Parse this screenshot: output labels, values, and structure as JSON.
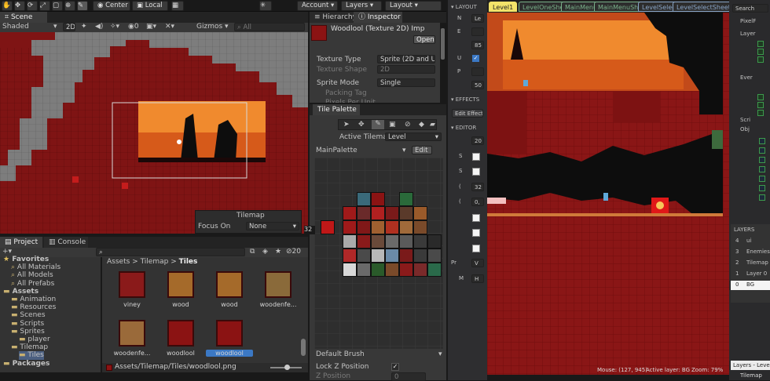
{
  "toolbar": {
    "center": "Center",
    "local": "Local",
    "account": "Account",
    "layers": "Layers",
    "layout": "Layout"
  },
  "scene": {
    "tab": "Scene",
    "shading": "Shaded",
    "mode2d": "2D",
    "gizmos": "Gizmos",
    "search_placeholder": "All"
  },
  "tilemap_overlay": {
    "title": "Tilemap",
    "focus_label": "Focus On",
    "focus_value": "None"
  },
  "project": {
    "tab_project": "Project",
    "tab_console": "Console",
    "count": "20",
    "tree": [
      {
        "label": "Favorites",
        "level": 0
      },
      {
        "label": "All Materials",
        "level": 1
      },
      {
        "label": "All Models",
        "level": 1
      },
      {
        "label": "All Prefabs",
        "level": 1
      },
      {
        "label": "Assets",
        "level": 0
      },
      {
        "label": "Animation",
        "level": 1
      },
      {
        "label": "Resources",
        "level": 1
      },
      {
        "label": "Scenes",
        "level": 1
      },
      {
        "label": "Scripts",
        "level": 1
      },
      {
        "label": "Sprites",
        "level": 1
      },
      {
        "label": "player",
        "level": 2
      },
      {
        "label": "Tilemap",
        "level": 1
      },
      {
        "label": "Tiles",
        "level": 2
      },
      {
        "label": "Packages",
        "level": 0
      }
    ],
    "breadcrumb": [
      "Assets",
      "Tilemap",
      "Tiles"
    ],
    "assets": [
      "viney",
      "wood",
      "wood",
      "woodenfe...",
      "woodenfe...",
      "woodlool",
      "woodlool"
    ],
    "path": "Assets/Tilemap/Tiles/woodlool.png"
  },
  "inspector": {
    "tab_hierarchy": "Hierarchy",
    "tab_inspector": "Inspector",
    "title": "Woodlool (Texture 2D) Imp",
    "open": "Open",
    "texture_type_label": "Texture Type",
    "texture_type_value": "Sprite (2D and UI)",
    "texture_shape_label": "Texture Shape",
    "texture_shape_value": "2D",
    "sprite_mode_label": "Sprite Mode",
    "sprite_mode_value": "Single",
    "packing_tag_label": "Packing Tag",
    "ppu_label": "Pixels Per Unit",
    "ppu_value": "32"
  },
  "tile_palette": {
    "tab": "Tile Palette",
    "active_tilemap_label": "Active Tilemap",
    "active_tilemap_value": "Level",
    "palette": "MainPalette",
    "edit": "Edit",
    "brush": "Default Brush",
    "lockz": "Lock Z Position",
    "zpos_label": "Z Position",
    "zpos_value": "0",
    "side_value": "32"
  },
  "ldtk": {
    "layout_header": "LAYOUT",
    "effects_header": "EFFECTS",
    "editor_header": "EDITOR",
    "edit_effects": "Edit Effects",
    "layout_rows": [
      {
        "label": "N",
        "value": "Le"
      },
      {
        "label": "E",
        "value": ""
      },
      {
        "label": "",
        "value": "85"
      },
      {
        "label": "U",
        "value": ""
      },
      {
        "label": "P",
        "value": ""
      },
      {
        "label": "",
        "value": "50"
      }
    ],
    "editor_rows": [
      {
        "label": "",
        "value": "20"
      },
      {
        "label": "S",
        "value": ""
      },
      {
        "label": "S",
        "value": ""
      },
      {
        "label": "(",
        "value": "32"
      },
      {
        "label": "(",
        "value": "0,"
      },
      {
        "label": "",
        "value": ""
      },
      {
        "label": "",
        "value": ""
      },
      {
        "label": "",
        "value": ""
      },
      {
        "label": "Pr",
        "value": "V"
      },
      {
        "label": "M",
        "value": "H"
      }
    ],
    "tabs": [
      {
        "label": "Level1",
        "color": "#f2e36a"
      },
      {
        "label": "LevelOneSheet",
        "color": "#7ab18a"
      },
      {
        "label": "MainMenu",
        "color": "#7ab18a"
      },
      {
        "label": "MainMenuSheet",
        "color": "#7ab18a"
      },
      {
        "label": "LevelSelect",
        "color": "#8aa6c8"
      },
      {
        "label": "LevelSelectSheet",
        "color": "#8aa6c8"
      }
    ],
    "status_mouse": "Mouse: (127, 945)",
    "status_layer": "Active layer: BG",
    "status_zoom": "Zoom: 79%"
  },
  "right": {
    "search": "Search",
    "tree": [
      "PixelF",
      "Layer",
      "Ever",
      "Scri",
      "Obj"
    ],
    "layers_header": "LAYERS",
    "layers": [
      {
        "num": "4",
        "name": "ui"
      },
      {
        "num": "3",
        "name": "Enemies"
      },
      {
        "num": "2",
        "name": "Tilemap"
      },
      {
        "num": "1",
        "name": "Layer 0"
      },
      {
        "num": "0",
        "name": "BG"
      }
    ],
    "bottom_tab": "Layers - Level1",
    "bottom_label": "Tilemap"
  },
  "colors": {
    "level_red": "#7d1212",
    "sky_orange": "#f08a2e",
    "accent_blue": "#3b78c4"
  }
}
